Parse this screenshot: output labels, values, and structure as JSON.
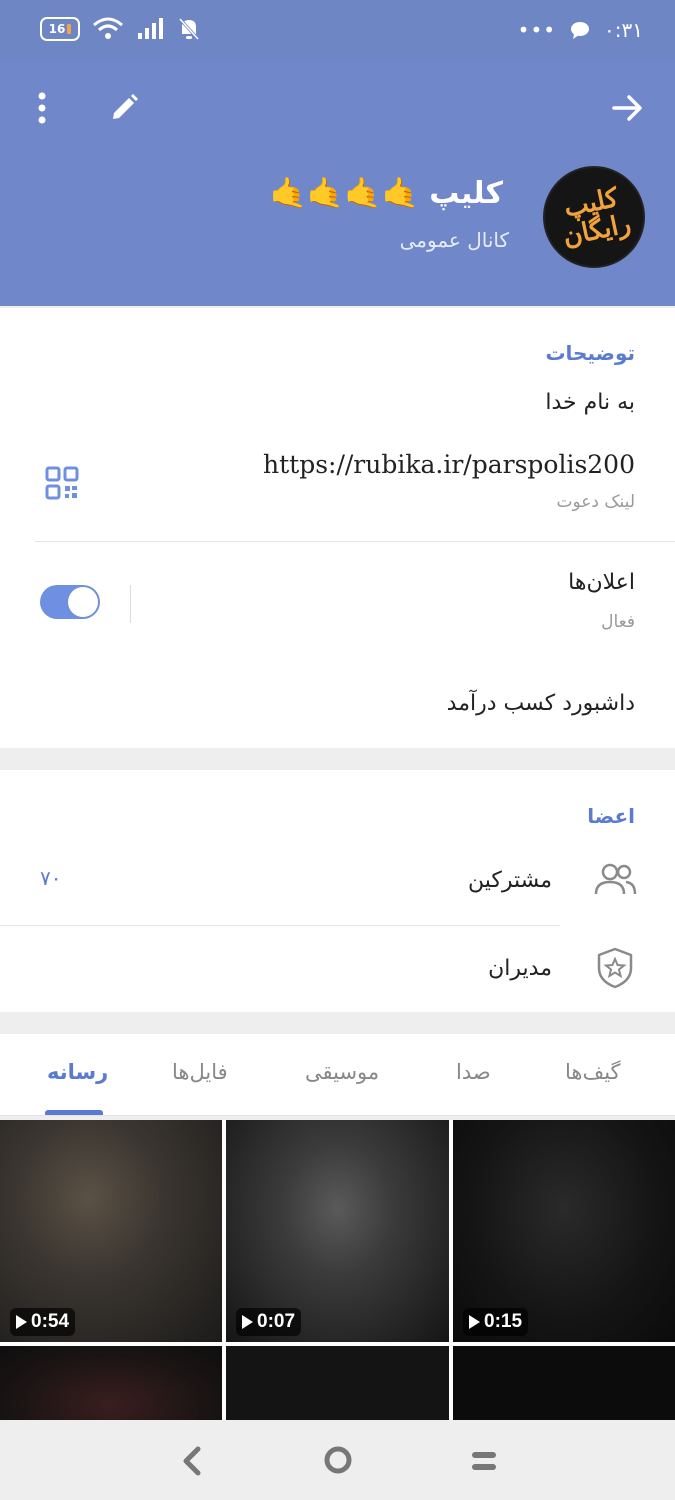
{
  "status_bar": {
    "battery": "16",
    "time": "۰:۳۱",
    "more_dots": "•••"
  },
  "header": {
    "channel_name": "کلیپ 🤙🤙🤙🤙",
    "channel_type": "کانال عمومی",
    "avatar_text": "کلیپ رایگان",
    "back_icon": "arrow-right-icon",
    "edit_icon": "pencil-icon",
    "menu_icon": "more-vertical-icon"
  },
  "info": {
    "section_title": "توضیحات",
    "description": "به نام خدا",
    "invite_link": "https://rubika.ir/parspolis200",
    "invite_link_label": "لینک دعوت",
    "notifications_label": "اعلان‌ها",
    "notifications_status": "فعال",
    "notifications_enabled": true,
    "dashboard_label": "داشبورد کسب درآمد"
  },
  "members": {
    "section_title": "اعضا",
    "subscribers_label": "مشترکین",
    "subscribers_count": "۷۰",
    "admins_label": "مدیران"
  },
  "media_tabs": [
    "گیف‌ها",
    "صدا",
    "موسیقی",
    "فایل‌ها",
    "رسانه"
  ],
  "active_tab": "رسانه",
  "media_grid": [
    {
      "duration": "0:54"
    },
    {
      "duration": "0:07"
    },
    {
      "duration": "0:15"
    },
    {
      "duration": ""
    },
    {
      "duration": ""
    },
    {
      "duration": ""
    }
  ],
  "colors": {
    "header_bg": "#7088c9",
    "accent": "#5a7bd0"
  }
}
